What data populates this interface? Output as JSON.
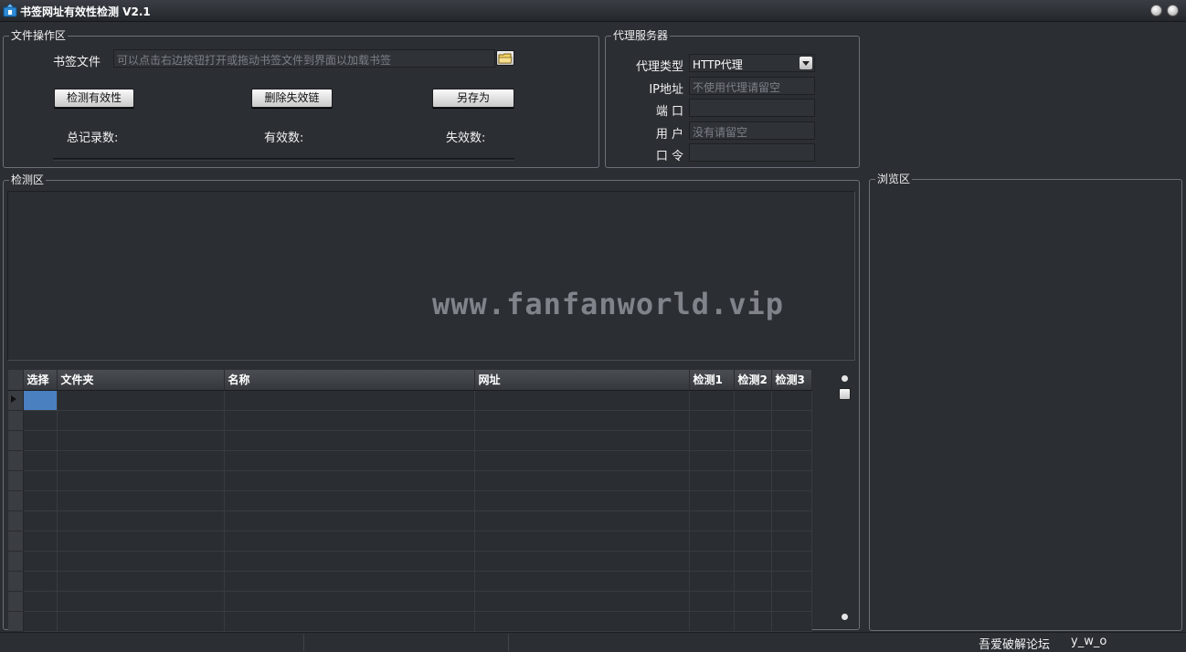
{
  "window": {
    "title": "书签网址有效性检测 V2.1",
    "icon": "bookmark-app-icon"
  },
  "file_group": {
    "legend": "文件操作区",
    "bookmark_label": "书签文件",
    "bookmark_placeholder": "可以点击右边按钮打开或拖动书签文件到界面以加载书签",
    "check_button": "检测有效性",
    "delete_button": "删除失效链",
    "save_as_button": "另存为",
    "total_label": "总记录数:",
    "valid_label": "有效数:",
    "invalid_label": "失效数:"
  },
  "proxy_group": {
    "legend": "代理服务器",
    "type_label": "代理类型",
    "type_value": "HTTP代理",
    "ip_label": "IP地址",
    "ip_placeholder": "不使用代理请留空",
    "port_label": "端 口",
    "port_value": "",
    "user_label": "用 户",
    "user_placeholder": "没有请留空",
    "password_label": "口 令",
    "password_value": ""
  },
  "detect_group": {
    "legend": "检测区",
    "watermark": "www.fanfanworld.vip",
    "columns": [
      "选择",
      "文件夹",
      "名称",
      "网址",
      "检测1",
      "检测2",
      "检测3"
    ],
    "row_count": 12
  },
  "browse_group": {
    "legend": "浏览区"
  },
  "status_bar": {
    "forum": "吾爱破解论坛",
    "author": "y_w_o"
  },
  "colors": {
    "background": "#2b2e33",
    "border": "#6d7078",
    "selected_cell": "#4a7fc0"
  }
}
